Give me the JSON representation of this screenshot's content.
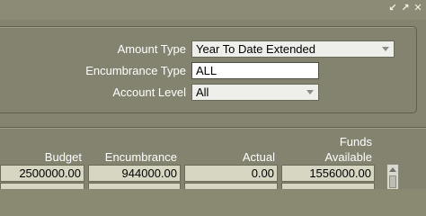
{
  "window": {
    "controls": [
      {
        "icon": "minimize-arrow-icon",
        "glyph": "↙"
      },
      {
        "icon": "restore-arrow-icon",
        "glyph": "↗"
      },
      {
        "icon": "close-icon",
        "glyph": "✕"
      }
    ]
  },
  "form": {
    "amount_type": {
      "label": "Amount Type",
      "value": "Year To Date Extended"
    },
    "encumbrance_type": {
      "label": "Encumbrance Type",
      "value": "ALL"
    },
    "account_level": {
      "label": "Account Level",
      "value": "All"
    }
  },
  "table": {
    "columns": [
      {
        "label": "Budget"
      },
      {
        "label": "Encumbrance"
      },
      {
        "label": "Actual"
      },
      {
        "label_line1": "Funds",
        "label_line2": "Available"
      }
    ],
    "rows": [
      [
        "2500000.00",
        "944000.00",
        "0.00",
        "1556000.00"
      ]
    ]
  },
  "colors": {
    "background": "#848470",
    "panel_border": "#5f5f4d",
    "label_text": "#ffffff",
    "cell_bg": "#d6d6c2"
  }
}
